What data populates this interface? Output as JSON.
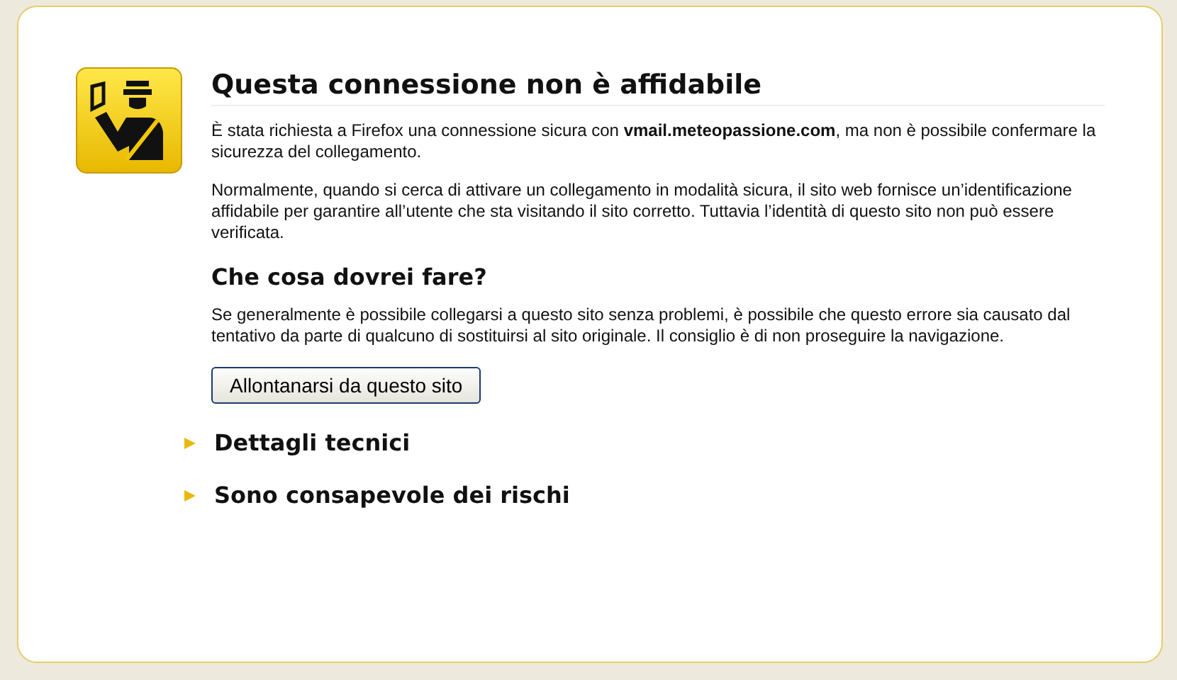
{
  "title": "Questa connessione non è affidabile",
  "paragraphs": [
    "È stata richiesta a Firefox una connessione sicura con **vmail.meteopassione.com**, ma non è possibile confermare la sicurezza del collegamento.",
    "Normalmente, quando si cerca di attivare un collegamento in modalità sicura, il sito web fornisce un’identificazione affidabile per garantire all’utente che sta visitando il sito corretto. Tuttavia l’identità di questo sito non può essere verificata."
  ],
  "what_to_do": {
    "heading": "Che cosa dovrei fare?",
    "text": "Se generalmente è possibile collegarsi a questo sito senza problemi, è possibile che questo errore sia causato dal tentativo da parte di qualcuno di sostituirsi al sito originale. Il consiglio è di non proseguire la navigazione.",
    "button": "Allontanarsi da questo sito"
  },
  "sections": [
    {
      "label": "Dettagli tecnici",
      "expanded": false
    },
    {
      "label": "Sono consapevole dei rischi",
      "expanded": false
    }
  ]
}
